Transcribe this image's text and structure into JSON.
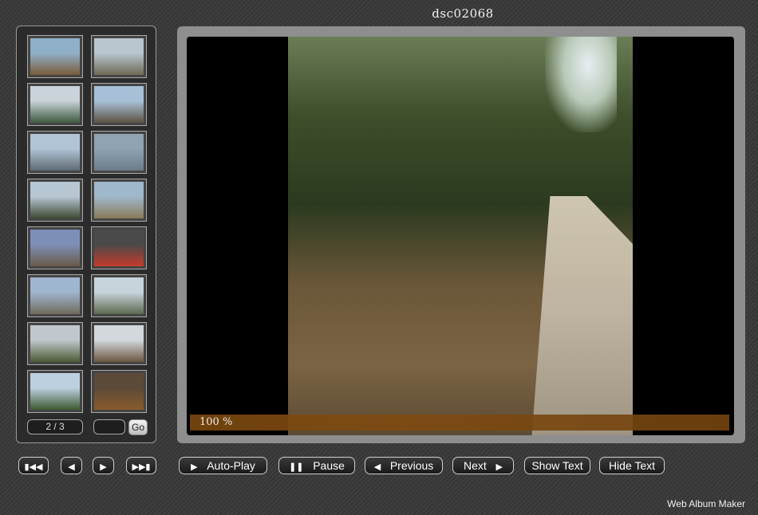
{
  "album_title": "dsc02068",
  "thumbnails": [
    {
      "label": "",
      "color_top": "#8fb0c8",
      "color_bottom": "#7a5b3a"
    },
    {
      "label": "",
      "color_top": "#b9c6cf",
      "color_bottom": "#6e6a55"
    },
    {
      "label": "",
      "color_top": "#c9d3da",
      "color_bottom": "#3f5a3f"
    },
    {
      "label": "",
      "color_top": "#a7c0d8",
      "color_bottom": "#5d5244"
    },
    {
      "label": "",
      "color_top": "#b0c4d6",
      "color_bottom": "#5f6a72"
    },
    {
      "label": "",
      "color_top": "#8fa3b2",
      "color_bottom": "#6b7c8a"
    },
    {
      "label": "",
      "color_top": "#b8c7d4",
      "color_bottom": "#3e4a32"
    },
    {
      "label": "",
      "color_top": "#9fb8cc",
      "color_bottom": "#8a7a58"
    },
    {
      "label": "",
      "color_top": "#7d8fb8",
      "color_bottom": "#6a5a4a"
    },
    {
      "label": "",
      "color_top": "#4a4a4a",
      "color_bottom": "#c43b2c"
    },
    {
      "label": "",
      "color_top": "#9fb6cf",
      "color_bottom": "#6f6a5c"
    },
    {
      "label": "",
      "color_top": "#c8d4dc",
      "color_bottom": "#5d6a4f"
    },
    {
      "label": "",
      "color_top": "#c0c8cd",
      "color_bottom": "#4d5a35"
    },
    {
      "label": "",
      "color_top": "#d2d8dc",
      "color_bottom": "#6b5740"
    },
    {
      "label": "",
      "color_top": "#bcd0e0",
      "color_bottom": "#3d5a30"
    },
    {
      "label": "",
      "color_top": "#5b4a38",
      "color_bottom": "#8a5a2c"
    }
  ],
  "pager": {
    "current": "2 / 3",
    "input_value": "",
    "go_label": "Go"
  },
  "viewer": {
    "progress_percent": 100,
    "progress_text": "100 %"
  },
  "nav": {
    "first_icon": "first-icon",
    "prev_icon": "prev-icon",
    "next_icon": "next-icon",
    "last_icon": "last-icon"
  },
  "controls": {
    "autoplay": "Auto-Play",
    "pause": "Pause",
    "previous": "Previous",
    "next": "Next",
    "show_text": "Show Text",
    "hide_text": "Hide Text"
  },
  "footer": "Web Album Maker"
}
